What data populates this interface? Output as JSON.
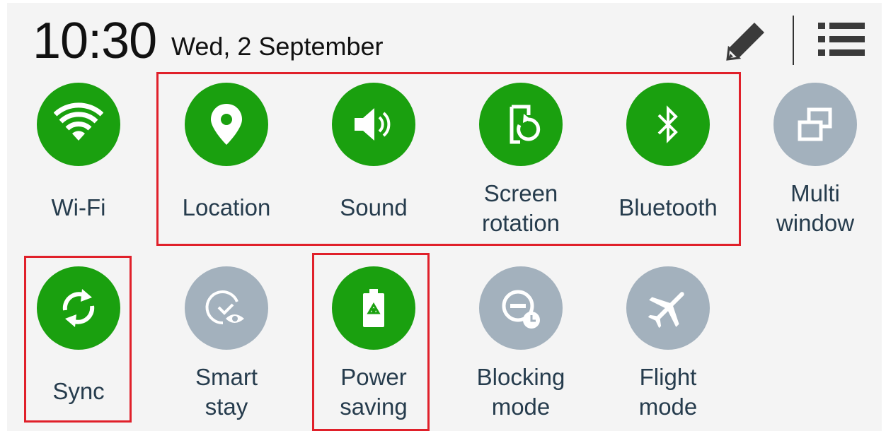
{
  "status_bar": {
    "time": "10:30",
    "date": "Wed, 2 September"
  },
  "icons": {
    "edit": "pencil-icon",
    "menu": "list-icon"
  },
  "colors": {
    "active": "#1aa00f",
    "inactive": "#a3b1bd",
    "label": "#263c4d",
    "highlight": "#e0202a"
  },
  "toggles": [
    {
      "label": "Wi-Fi",
      "icon": "wifi-icon",
      "state": "on"
    },
    {
      "label": "Location",
      "icon": "location-pin-icon",
      "state": "on"
    },
    {
      "label": "Sound",
      "icon": "speaker-icon",
      "state": "on"
    },
    {
      "label": "Screen\nrotation",
      "icon": "screen-rotation-icon",
      "state": "on"
    },
    {
      "label": "Bluetooth",
      "icon": "bluetooth-icon",
      "state": "on"
    },
    {
      "label": "Multi\nwindow",
      "icon": "multi-window-icon",
      "state": "off"
    },
    {
      "label": "Sync",
      "icon": "sync-icon",
      "state": "on"
    },
    {
      "label": "Smart\nstay",
      "icon": "smart-stay-icon",
      "state": "off"
    },
    {
      "label": "Power\nsaving",
      "icon": "battery-recycle-icon",
      "state": "on"
    },
    {
      "label": "Blocking\nmode",
      "icon": "blocking-mode-icon",
      "state": "off"
    },
    {
      "label": "Flight\nmode",
      "icon": "airplane-icon",
      "state": "off"
    }
  ]
}
